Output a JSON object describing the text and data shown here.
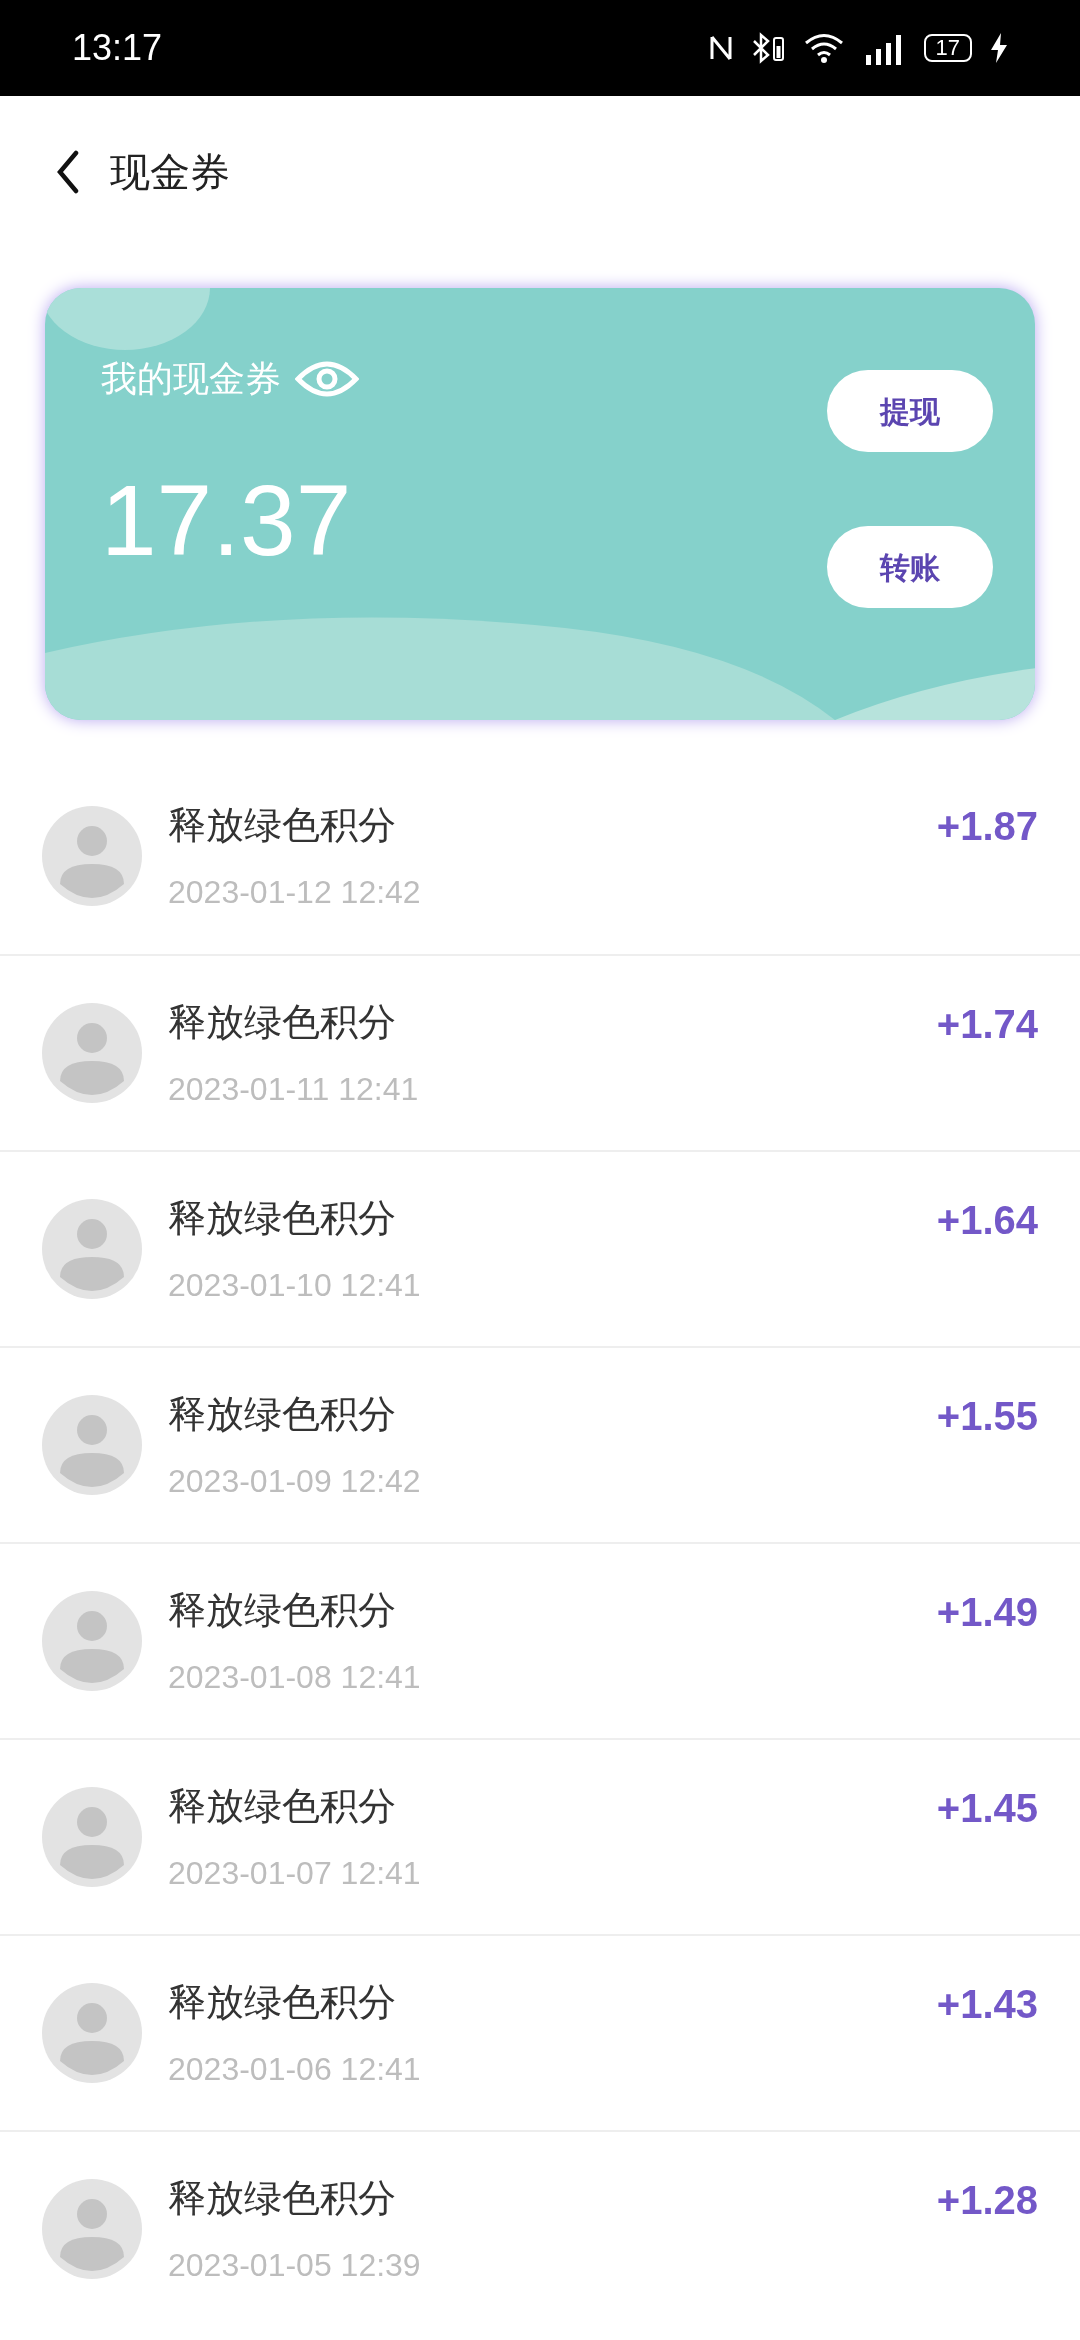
{
  "status_bar": {
    "time": "13:17",
    "battery": "17"
  },
  "header": {
    "title": "现金券"
  },
  "card": {
    "label": "我的现金券",
    "balance": "17.37",
    "buttons": [
      "提现",
      "转账"
    ]
  },
  "records": [
    {
      "title": "释放绿色积分",
      "time": "2023-01-12 12:42",
      "amount": "+1.87"
    },
    {
      "title": "释放绿色积分",
      "time": "2023-01-11 12:41",
      "amount": "+1.74"
    },
    {
      "title": "释放绿色积分",
      "time": "2023-01-10 12:41",
      "amount": "+1.64"
    },
    {
      "title": "释放绿色积分",
      "time": "2023-01-09 12:42",
      "amount": "+1.55"
    },
    {
      "title": "释放绿色积分",
      "time": "2023-01-08 12:41",
      "amount": "+1.49"
    },
    {
      "title": "释放绿色积分",
      "time": "2023-01-07 12:41",
      "amount": "+1.45"
    },
    {
      "title": "释放绿色积分",
      "time": "2023-01-06 12:41",
      "amount": "+1.43"
    },
    {
      "title": "释放绿色积分",
      "time": "2023-01-05 12:39",
      "amount": "+1.28"
    }
  ]
}
